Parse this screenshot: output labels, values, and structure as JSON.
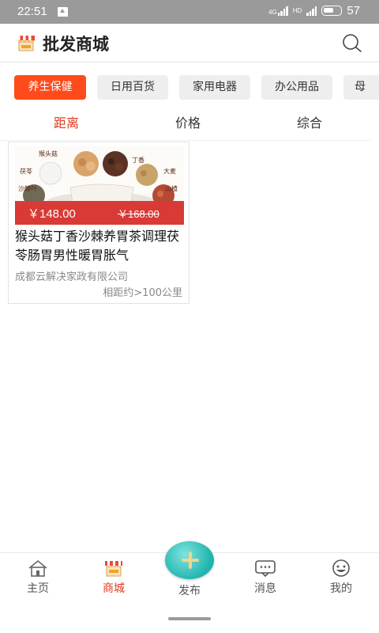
{
  "status_bar": {
    "time": "22:51",
    "battery": "57",
    "network": "4G",
    "hd": "HD"
  },
  "header": {
    "title": "批发商城"
  },
  "categories": [
    {
      "label": "养生保健",
      "active": true
    },
    {
      "label": "日用百货",
      "active": false
    },
    {
      "label": "家用电器",
      "active": false
    },
    {
      "label": "办公用品",
      "active": false
    },
    {
      "label": "母",
      "active": false
    }
  ],
  "sort_tabs": [
    {
      "label": "距离",
      "active": true
    },
    {
      "label": "价格",
      "active": false
    },
    {
      "label": "综合",
      "active": false
    }
  ],
  "products": [
    {
      "price": "￥148.00",
      "original_price": "￥168.00",
      "name": "猴头菇丁香沙棘养胃茶调理茯苓肠胃男性暖胃胀气",
      "company": "成都云解决家政有限公司",
      "distance": "相距约>100公里",
      "image_labels": [
        "猴头菇",
        "丁香",
        "茯苓",
        "大麦",
        "沙棘叶",
        "山楂"
      ]
    }
  ],
  "tabbar": {
    "items": [
      {
        "label": "主页",
        "icon": "home-icon",
        "active": false
      },
      {
        "label": "商城",
        "icon": "shop-icon",
        "active": true
      },
      {
        "label": "发布",
        "icon": "plus-icon",
        "active": false
      },
      {
        "label": "消息",
        "icon": "message-icon",
        "active": false
      },
      {
        "label": "我的",
        "icon": "profile-icon",
        "active": false
      }
    ]
  },
  "colors": {
    "accent": "#ff4a1c",
    "active_text": "#e03a1e",
    "price_band": "#d93a35",
    "publish": "#1fb4ad"
  }
}
